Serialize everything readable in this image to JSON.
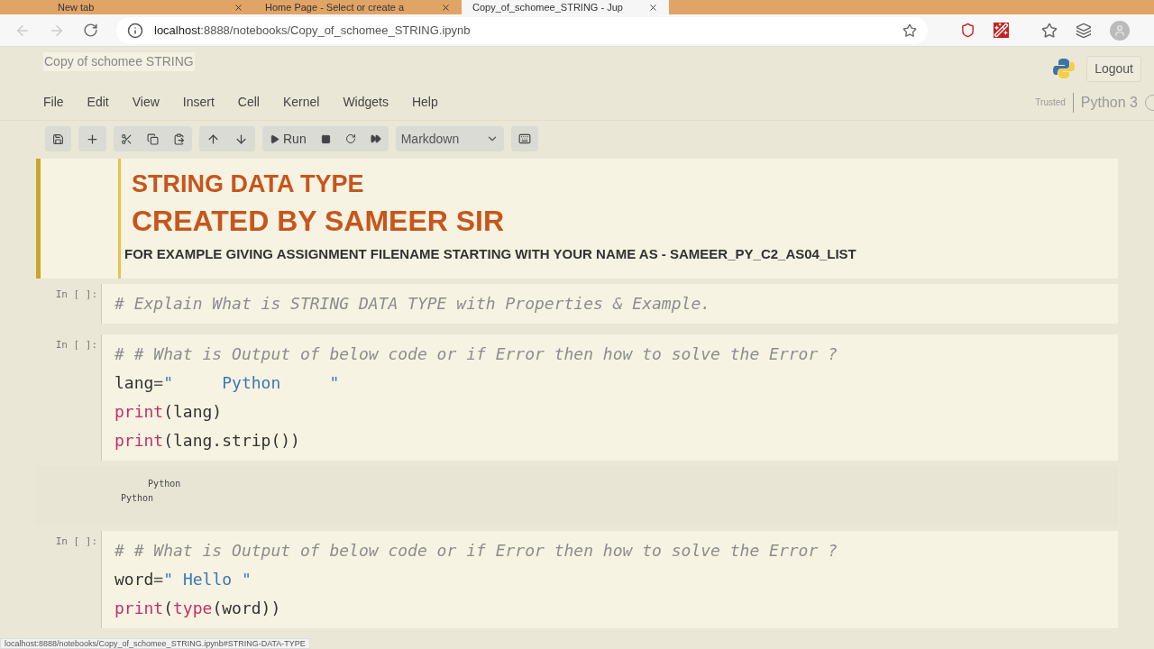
{
  "browser": {
    "tabs": [
      {
        "title": "New tab",
        "selected": false
      },
      {
        "title": "Home Page - Select or create a",
        "selected": false
      },
      {
        "title": "Copy_of_schomee_STRING - Jup",
        "selected": true
      }
    ],
    "address": {
      "host": "localhost",
      "rest": ":8888/notebooks/Copy_of_schomee_STRING.ipynb"
    }
  },
  "notebook": {
    "title": "Copy of schomee STRING",
    "logout": "Logout",
    "menu": [
      "File",
      "Edit",
      "View",
      "Insert",
      "Cell",
      "Kernel",
      "Widgets",
      "Help"
    ],
    "trusted": "Trusted",
    "kernel": "Python 3",
    "run": "Run",
    "cell_type": "Markdown"
  },
  "cells": [
    {
      "kind": "markdown",
      "selected": true,
      "h1": "STRING DATA TYPE",
      "h2": "CREATED BY SAMEER SIR",
      "note": "FOR EXAMPLE GIVING ASSIGNMENT FILENAME STARTING WITH YOUR NAME AS - SAMEER_PY_C2_AS04_LIST"
    },
    {
      "kind": "code",
      "prompt": "In [ ]:",
      "lines": [
        [
          {
            "kind": "comment",
            "text": "# Explain What is STRING DATA TYPE with Properties & Example."
          }
        ]
      ]
    },
    {
      "kind": "code",
      "prompt": "In [ ]:",
      "lines": [
        [
          {
            "kind": "comment",
            "text": "# # What is Output of below code or if Error then how to solve the Error ?"
          }
        ],
        [
          {
            "kind": "name",
            "text": "lang"
          },
          {
            "kind": "op",
            "text": "="
          },
          {
            "kind": "string",
            "text": "\"     Python     \""
          }
        ],
        [
          {
            "kind": "builtin",
            "text": "print"
          },
          {
            "kind": "name",
            "text": "(lang)"
          }
        ],
        [
          {
            "kind": "builtin",
            "text": "print"
          },
          {
            "kind": "name",
            "text": "(lang.strip())"
          }
        ]
      ]
    },
    {
      "kind": "output",
      "lines": [
        "     Python",
        "Python"
      ]
    },
    {
      "kind": "code",
      "prompt": "In [ ]:",
      "lines": [
        [
          {
            "kind": "comment",
            "text": "# # What is Output of below code or if Error then how to solve the Error ?"
          }
        ],
        [
          {
            "kind": "name",
            "text": "word"
          },
          {
            "kind": "op",
            "text": "="
          },
          {
            "kind": "string",
            "text": "\" Hello \""
          }
        ],
        [
          {
            "kind": "builtin",
            "text": "print"
          },
          {
            "kind": "name",
            "text": "("
          },
          {
            "kind": "builtin",
            "text": "type"
          },
          {
            "kind": "name",
            "text": "(word))"
          }
        ]
      ]
    }
  ],
  "status_bar": "localhost:8888/notebooks/Copy_of_schomee_STRING.ipynb#STRING-DATA-TYPE"
}
